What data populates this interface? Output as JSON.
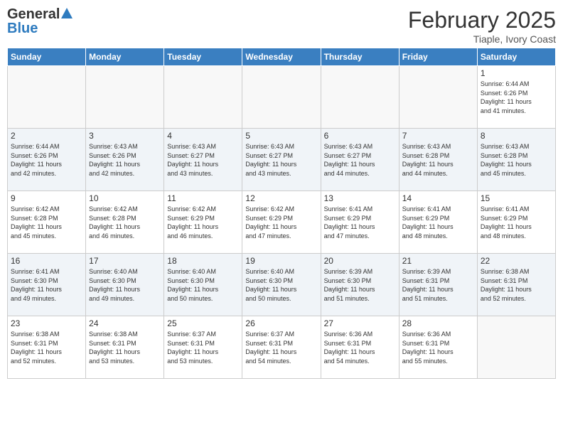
{
  "logo": {
    "general": "General",
    "blue": "Blue"
  },
  "header": {
    "month": "February 2025",
    "location": "Tiaple, Ivory Coast"
  },
  "weekdays": [
    "Sunday",
    "Monday",
    "Tuesday",
    "Wednesday",
    "Thursday",
    "Friday",
    "Saturday"
  ],
  "weeks": [
    [
      {
        "day": "",
        "info": ""
      },
      {
        "day": "",
        "info": ""
      },
      {
        "day": "",
        "info": ""
      },
      {
        "day": "",
        "info": ""
      },
      {
        "day": "",
        "info": ""
      },
      {
        "day": "",
        "info": ""
      },
      {
        "day": "1",
        "info": "Sunrise: 6:44 AM\nSunset: 6:26 PM\nDaylight: 11 hours\nand 41 minutes."
      }
    ],
    [
      {
        "day": "2",
        "info": "Sunrise: 6:44 AM\nSunset: 6:26 PM\nDaylight: 11 hours\nand 42 minutes."
      },
      {
        "day": "3",
        "info": "Sunrise: 6:43 AM\nSunset: 6:26 PM\nDaylight: 11 hours\nand 42 minutes."
      },
      {
        "day": "4",
        "info": "Sunrise: 6:43 AM\nSunset: 6:27 PM\nDaylight: 11 hours\nand 43 minutes."
      },
      {
        "day": "5",
        "info": "Sunrise: 6:43 AM\nSunset: 6:27 PM\nDaylight: 11 hours\nand 43 minutes."
      },
      {
        "day": "6",
        "info": "Sunrise: 6:43 AM\nSunset: 6:27 PM\nDaylight: 11 hours\nand 44 minutes."
      },
      {
        "day": "7",
        "info": "Sunrise: 6:43 AM\nSunset: 6:28 PM\nDaylight: 11 hours\nand 44 minutes."
      },
      {
        "day": "8",
        "info": "Sunrise: 6:43 AM\nSunset: 6:28 PM\nDaylight: 11 hours\nand 45 minutes."
      }
    ],
    [
      {
        "day": "9",
        "info": "Sunrise: 6:42 AM\nSunset: 6:28 PM\nDaylight: 11 hours\nand 45 minutes."
      },
      {
        "day": "10",
        "info": "Sunrise: 6:42 AM\nSunset: 6:28 PM\nDaylight: 11 hours\nand 46 minutes."
      },
      {
        "day": "11",
        "info": "Sunrise: 6:42 AM\nSunset: 6:29 PM\nDaylight: 11 hours\nand 46 minutes."
      },
      {
        "day": "12",
        "info": "Sunrise: 6:42 AM\nSunset: 6:29 PM\nDaylight: 11 hours\nand 47 minutes."
      },
      {
        "day": "13",
        "info": "Sunrise: 6:41 AM\nSunset: 6:29 PM\nDaylight: 11 hours\nand 47 minutes."
      },
      {
        "day": "14",
        "info": "Sunrise: 6:41 AM\nSunset: 6:29 PM\nDaylight: 11 hours\nand 48 minutes."
      },
      {
        "day": "15",
        "info": "Sunrise: 6:41 AM\nSunset: 6:29 PM\nDaylight: 11 hours\nand 48 minutes."
      }
    ],
    [
      {
        "day": "16",
        "info": "Sunrise: 6:41 AM\nSunset: 6:30 PM\nDaylight: 11 hours\nand 49 minutes."
      },
      {
        "day": "17",
        "info": "Sunrise: 6:40 AM\nSunset: 6:30 PM\nDaylight: 11 hours\nand 49 minutes."
      },
      {
        "day": "18",
        "info": "Sunrise: 6:40 AM\nSunset: 6:30 PM\nDaylight: 11 hours\nand 50 minutes."
      },
      {
        "day": "19",
        "info": "Sunrise: 6:40 AM\nSunset: 6:30 PM\nDaylight: 11 hours\nand 50 minutes."
      },
      {
        "day": "20",
        "info": "Sunrise: 6:39 AM\nSunset: 6:30 PM\nDaylight: 11 hours\nand 51 minutes."
      },
      {
        "day": "21",
        "info": "Sunrise: 6:39 AM\nSunset: 6:31 PM\nDaylight: 11 hours\nand 51 minutes."
      },
      {
        "day": "22",
        "info": "Sunrise: 6:38 AM\nSunset: 6:31 PM\nDaylight: 11 hours\nand 52 minutes."
      }
    ],
    [
      {
        "day": "23",
        "info": "Sunrise: 6:38 AM\nSunset: 6:31 PM\nDaylight: 11 hours\nand 52 minutes."
      },
      {
        "day": "24",
        "info": "Sunrise: 6:38 AM\nSunset: 6:31 PM\nDaylight: 11 hours\nand 53 minutes."
      },
      {
        "day": "25",
        "info": "Sunrise: 6:37 AM\nSunset: 6:31 PM\nDaylight: 11 hours\nand 53 minutes."
      },
      {
        "day": "26",
        "info": "Sunrise: 6:37 AM\nSunset: 6:31 PM\nDaylight: 11 hours\nand 54 minutes."
      },
      {
        "day": "27",
        "info": "Sunrise: 6:36 AM\nSunset: 6:31 PM\nDaylight: 11 hours\nand 54 minutes."
      },
      {
        "day": "28",
        "info": "Sunrise: 6:36 AM\nSunset: 6:31 PM\nDaylight: 11 hours\nand 55 minutes."
      },
      {
        "day": "",
        "info": ""
      }
    ]
  ]
}
